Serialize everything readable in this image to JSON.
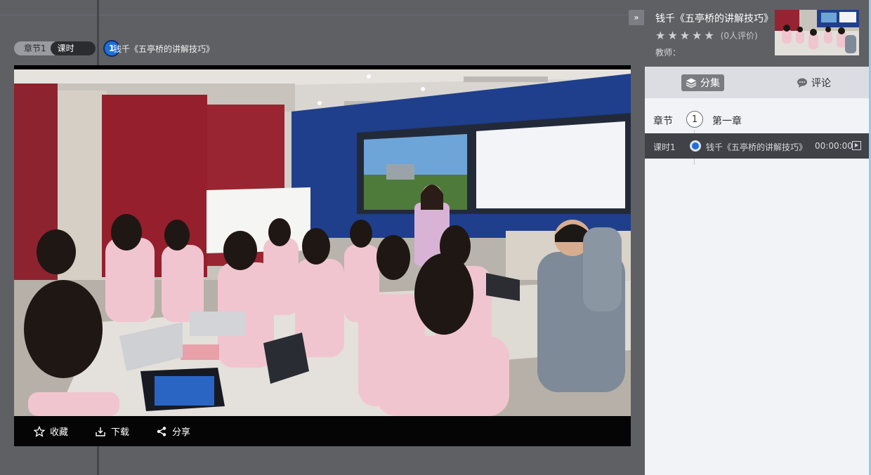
{
  "breadcrumb": {
    "chapter": "章节1",
    "lesson": "课时",
    "lesson_number": "1",
    "title": "钱千《五亭桥的讲解技巧》"
  },
  "player": {
    "actions": [
      {
        "label": "收藏",
        "icon": "star-outline-icon"
      },
      {
        "label": "下载",
        "icon": "download-icon"
      },
      {
        "label": "分享",
        "icon": "share-icon"
      }
    ]
  },
  "sidebar": {
    "expand_glyph": "»",
    "course_title": "钱千《五亭桥的讲解技巧》",
    "rating": {
      "stars": 5,
      "filled": 0,
      "count_text": "(0人评价)"
    },
    "teacher_label": "教师：",
    "tabs": [
      {
        "label": "分集",
        "active": true
      },
      {
        "label": "评论",
        "active": false
      }
    ],
    "chapter": {
      "label": "章节",
      "number": "1",
      "name": "第一章"
    },
    "lessons": [
      {
        "label": "课时1",
        "title": "钱千《五亭桥的讲解技巧》",
        "duration": "00:00:00",
        "active": true
      }
    ]
  },
  "colors": {
    "accent": "#1e6fd9",
    "stage_bg": "#5f6064",
    "sidebar_bg": "#f2f3f7",
    "active_row": "#414247"
  }
}
